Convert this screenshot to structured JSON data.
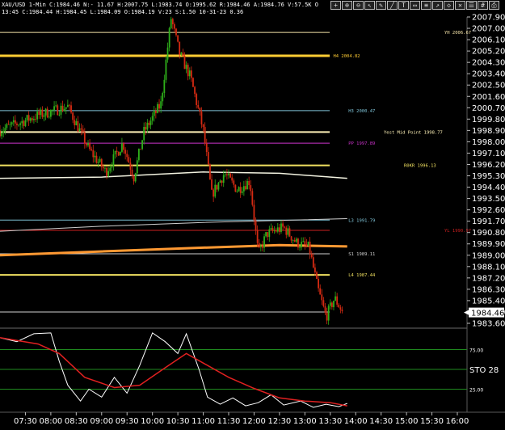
{
  "header": {
    "line1": "XAU/USD 1-Min C:1984.46 N:- 11.67 H:2007.75 L:1983.74 O:1995.62 R:1984.46 A:1984.76 V:57.5K O",
    "line2": "13:45 C:1984.44 H:1984.45 L:1984.09 O:1984.19 V:23 S:1.50 10-31-23 0.36"
  },
  "toolbar": {
    "icons": [
      "crosshair-icon",
      "zoom-in-icon",
      "zoom-out-icon",
      "cursor-icon",
      "pencil-icon",
      "line-tool-icon",
      "text-tool-icon",
      "ruler-icon",
      "fibonacci-icon",
      "arrow-icon",
      "shape-icon",
      "delete-icon",
      "properties-icon",
      "grid-icon",
      "print-icon"
    ],
    "glyphs": [
      "+",
      "⊕",
      "⊖",
      "↖",
      "✎",
      "╱",
      "T",
      "▭",
      "≡",
      "↗",
      "◇",
      "✕",
      "☰",
      "#",
      "⎙"
    ]
  },
  "colors": {
    "background": "#000000",
    "candle_up": "#2fb01a",
    "candle_down": "#d42a12",
    "grid": "#1f3a1f",
    "sto_main": "#ffffff",
    "sto_signal": "#e02020",
    "price_marker_bg": "#ffffff",
    "price_marker_text": "#000000"
  },
  "chart_data": {
    "type": "candlestick",
    "symbol": "XAU/USD",
    "interval": "1-Min",
    "y_ticks": [
      "2007.90",
      "2007.00",
      "2006.10",
      "2005.20",
      "2004.30",
      "2003.40",
      "2002.50",
      "2001.60",
      "2000.70",
      "1999.80",
      "1998.90",
      "1998.00",
      "1997.10",
      "1996.20",
      "1995.30",
      "1994.40",
      "1993.50",
      "1992.60",
      "1991.70",
      "1990.80",
      "1989.90",
      "1989.00",
      "1988.10",
      "1987.20",
      "1986.30",
      "1985.40",
      "1984.50",
      "1983.60"
    ],
    "current_price": "1984.46",
    "x_ticks": [
      "07:30",
      "08:00",
      "08:30",
      "09:00",
      "09:30",
      "10:00",
      "10:30",
      "11:00",
      "11:30",
      "12:00",
      "12:30",
      "13:00",
      "13:30",
      "14:00",
      "14:30",
      "15:00",
      "15:30",
      "16:00"
    ],
    "key_points": [
      {
        "time": "07:00",
        "price": 1998.9
      },
      {
        "time": "07:15",
        "price": 1999.3
      },
      {
        "time": "07:45",
        "price": 2000.1
      },
      {
        "time": "08:20",
        "price": 2000.8
      },
      {
        "time": "08:45",
        "price": 1997.4
      },
      {
        "time": "09:05",
        "price": 1995.6
      },
      {
        "time": "09:25",
        "price": 1997.9
      },
      {
        "time": "09:38",
        "price": 1995.2
      },
      {
        "time": "09:50",
        "price": 1998.8
      },
      {
        "time": "10:10",
        "price": 2001.0
      },
      {
        "time": "10:22",
        "price": 2007.8
      },
      {
        "time": "10:32",
        "price": 2005.0
      },
      {
        "time": "10:45",
        "price": 2003.1
      },
      {
        "time": "11:00",
        "price": 1998.9
      },
      {
        "time": "11:10",
        "price": 1993.8
      },
      {
        "time": "11:25",
        "price": 1995.5
      },
      {
        "time": "11:40",
        "price": 1994.2
      },
      {
        "time": "11:55",
        "price": 1994.9
      },
      {
        "time": "12:05",
        "price": 1989.1
      },
      {
        "time": "12:15",
        "price": 1990.7
      },
      {
        "time": "12:35",
        "price": 1991.2
      },
      {
        "time": "12:50",
        "price": 1990.0
      },
      {
        "time": "13:05",
        "price": 1989.6
      },
      {
        "time": "13:15",
        "price": 1986.4
      },
      {
        "time": "13:25",
        "price": 1984.1
      },
      {
        "time": "13:35",
        "price": 1985.6
      },
      {
        "time": "13:45",
        "price": 1984.46
      }
    ],
    "levels": [
      {
        "label": "YH 2006.67",
        "price": 2006.67,
        "color": "#f4e3a8",
        "label_x": 0.88,
        "width": 1
      },
      {
        "label": "H4 2004.82",
        "price": 2004.82,
        "color": "#ffcc33",
        "label_x": 0.66,
        "width": 3
      },
      {
        "label": "H3 2000.47",
        "price": 2000.47,
        "color": "#7fc4d8",
        "label_x": 0.69,
        "width": 1
      },
      {
        "label": "Yest Mid Point 1998.77",
        "price": 1998.77,
        "color": "#fff2b8",
        "label_x": 0.76,
        "width": 2
      },
      {
        "label": "PP 1997.89",
        "price": 1997.89,
        "color": "#cc33cc",
        "label_x": 0.69,
        "width": 1
      },
      {
        "label": "R0KR 1996.13",
        "price": 1996.13,
        "color": "#f0e060",
        "label_x": 0.8,
        "width": 2
      },
      {
        "label": "L3 1991.79",
        "price": 1991.79,
        "color": "#7fc4d8",
        "label_x": 0.69,
        "width": 1
      },
      {
        "label": "YL 1990.97",
        "price": 1990.97,
        "color": "#cc1f1f",
        "label_x": 0.88,
        "width": 1
      },
      {
        "label": "S1 1989.11",
        "price": 1989.11,
        "color": "#d0d0d0",
        "label_x": 0.69,
        "width": 1
      },
      {
        "label": "L4 1987.44",
        "price": 1987.44,
        "color": "#f0e060",
        "label_x": 0.69,
        "width": 2
      },
      {
        "label": "",
        "price": 1984.5,
        "color": "#d0d0d0",
        "label_x": 0,
        "width": 1
      }
    ],
    "moving_averages": [
      {
        "name": "white-ma",
        "color": "#f2f2e0",
        "width": 1.5,
        "points": [
          [
            "07:00",
            1995.1
          ],
          [
            "09:00",
            1995.2
          ],
          [
            "11:00",
            1995.6
          ],
          [
            "12:30",
            1995.5
          ],
          [
            "13:50",
            1995.1
          ]
        ]
      },
      {
        "name": "orange-ma",
        "color": "#ff9933",
        "width": 3,
        "points": [
          [
            "07:00",
            1989.0
          ],
          [
            "09:00",
            1989.3
          ],
          [
            "11:00",
            1989.6
          ],
          [
            "12:30",
            1989.8
          ],
          [
            "13:50",
            1989.7
          ]
        ]
      },
      {
        "name": "gray-ma",
        "color": "#cfcfcf",
        "width": 1,
        "points": [
          [
            "07:00",
            1990.9
          ],
          [
            "09:00",
            1991.3
          ],
          [
            "11:00",
            1991.6
          ],
          [
            "13:50",
            1991.9
          ]
        ]
      }
    ],
    "stochastic": {
      "label": "STO",
      "value": "28",
      "y_ticks": [
        "75.00",
        "25.00"
      ],
      "levels": [
        75,
        50,
        25
      ],
      "main": [
        [
          "07:00",
          90
        ],
        [
          "07:20",
          85
        ],
        [
          "07:40",
          95
        ],
        [
          "08:00",
          96
        ],
        [
          "08:10",
          60
        ],
        [
          "08:20",
          30
        ],
        [
          "08:35",
          10
        ],
        [
          "08:45",
          25
        ],
        [
          "09:00",
          15
        ],
        [
          "09:15",
          40
        ],
        [
          "09:30",
          20
        ],
        [
          "09:45",
          55
        ],
        [
          "10:00",
          96
        ],
        [
          "10:15",
          85
        ],
        [
          "10:30",
          70
        ],
        [
          "10:40",
          95
        ],
        [
          "10:55",
          50
        ],
        [
          "11:05",
          15
        ],
        [
          "11:20",
          6
        ],
        [
          "11:35",
          14
        ],
        [
          "11:50",
          4
        ],
        [
          "12:05",
          8
        ],
        [
          "12:20",
          18
        ],
        [
          "12:35",
          5
        ],
        [
          "12:55",
          10
        ],
        [
          "13:10",
          2
        ],
        [
          "13:25",
          6
        ],
        [
          "13:40",
          3
        ],
        [
          "13:50",
          7
        ]
      ],
      "signal": [
        [
          "07:00",
          90
        ],
        [
          "07:45",
          82
        ],
        [
          "08:10",
          70
        ],
        [
          "08:40",
          40
        ],
        [
          "09:15",
          27
        ],
        [
          "09:45",
          30
        ],
        [
          "10:15",
          52
        ],
        [
          "10:40",
          70
        ],
        [
          "11:00",
          58
        ],
        [
          "11:30",
          40
        ],
        [
          "12:00",
          26
        ],
        [
          "12:30",
          14
        ],
        [
          "13:00",
          10
        ],
        [
          "13:30",
          8
        ],
        [
          "13:50",
          4
        ]
      ]
    }
  }
}
